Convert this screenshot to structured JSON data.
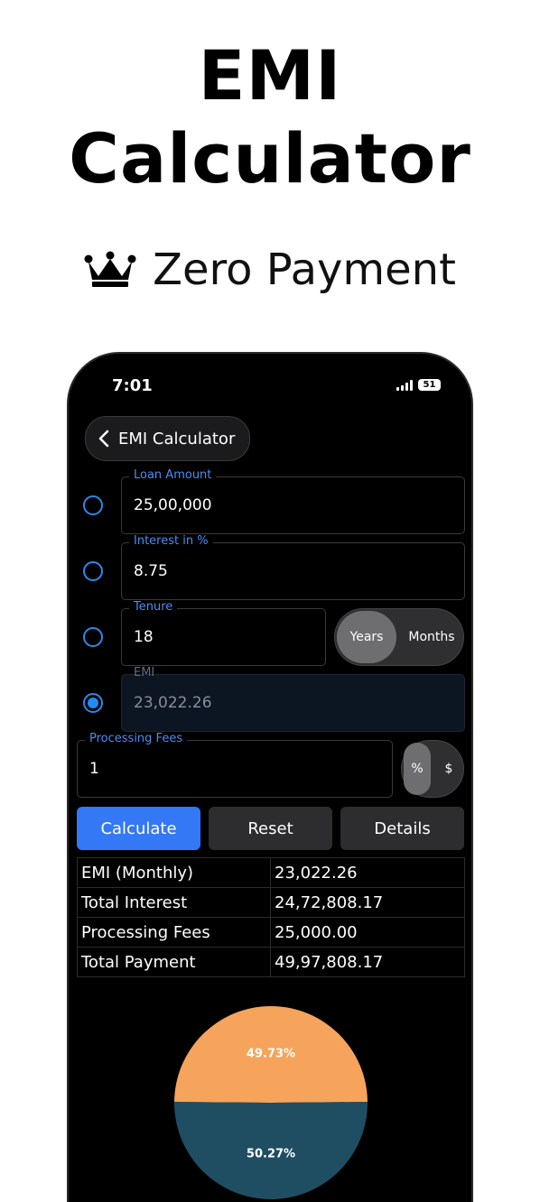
{
  "promo": {
    "title_line1": "EMI",
    "title_line2": "Calculator",
    "subtitle": "Zero Payment",
    "crown_icon": "crown-icon"
  },
  "status_bar": {
    "time": "7:01",
    "battery": "51"
  },
  "header": {
    "back_label": "EMI Calculator"
  },
  "form": {
    "loan_amount": {
      "label": "Loan Amount",
      "value": "25,00,000"
    },
    "interest": {
      "label": "Interest in %",
      "value": "8.75"
    },
    "tenure": {
      "label": "Tenure",
      "value": "18"
    },
    "tenure_units": {
      "years": "Years",
      "months": "Months",
      "selected": "Years"
    },
    "emi": {
      "label": "EMI",
      "value": "23,022.26"
    },
    "processing_fees": {
      "label": "Processing Fees",
      "value": "1"
    },
    "fee_units": {
      "percent": "%",
      "dollar": "$",
      "selected": "%"
    },
    "selected_radio": "emi"
  },
  "actions": {
    "calculate": "Calculate",
    "reset": "Reset",
    "details": "Details"
  },
  "summary": [
    {
      "label": "EMI (Monthly)",
      "value": "23,022.26"
    },
    {
      "label": "Total Interest",
      "value": "24,72,808.17"
    },
    {
      "label": "Processing Fees",
      "value": "25,000.00"
    },
    {
      "label": "Total Payment",
      "value": "49,97,808.17"
    }
  ],
  "chart_data": {
    "type": "pie",
    "slices": [
      {
        "label": "49.73%",
        "value": 49.73,
        "color": "#f6a45b"
      },
      {
        "label": "50.27%",
        "value": 50.27,
        "color": "#1f4e63"
      }
    ]
  },
  "colors": {
    "accent": "#3478f6",
    "label_blue": "#4d8cf2"
  }
}
